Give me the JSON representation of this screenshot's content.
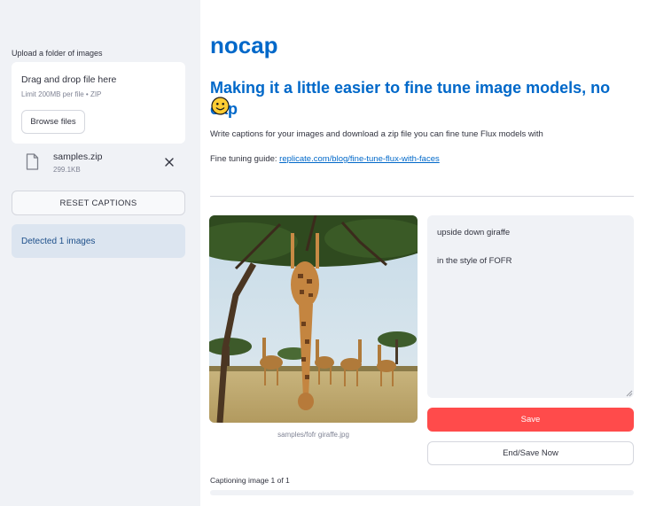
{
  "sidebar": {
    "upload_label": "Upload a folder of images",
    "dropzone": {
      "title": "Drag and drop file here",
      "limit": "Limit 200MB per file • ZIP",
      "browse_label": "Browse files"
    },
    "file": {
      "name": "samples.zip",
      "size": "299.1KB",
      "icon": "file-icon",
      "remove_icon": "close-icon"
    },
    "reset_label": "RESET CAPTIONS",
    "info_text": "Detected 1 images"
  },
  "main": {
    "title": "nocap",
    "subtitle": "Making it a little easier to fine tune image models, no cap",
    "subtitle_emoji": "slightly-smiling-face-icon",
    "description": "Write captions for your images and download a zip file you can fine tune Flux models with",
    "guide_prefix": "Fine tuning guide: ",
    "guide_link": "replicate.com/blog/fine-tune-flux-with-faces",
    "image_caption": "samples/fofr giraffe.jpg",
    "caption_text": "upside down giraffe\n\nin the style of FOFR",
    "save_label": "Save",
    "end_label": "End/Save Now",
    "progress_label": "Captioning image 1 of 1",
    "progress_value": 1.0
  },
  "colors": {
    "accent": "#0068c9",
    "primary_button": "#ff4b4b",
    "sidebar_bg": "#f0f2f6",
    "info_bg": "#dce5f0"
  }
}
